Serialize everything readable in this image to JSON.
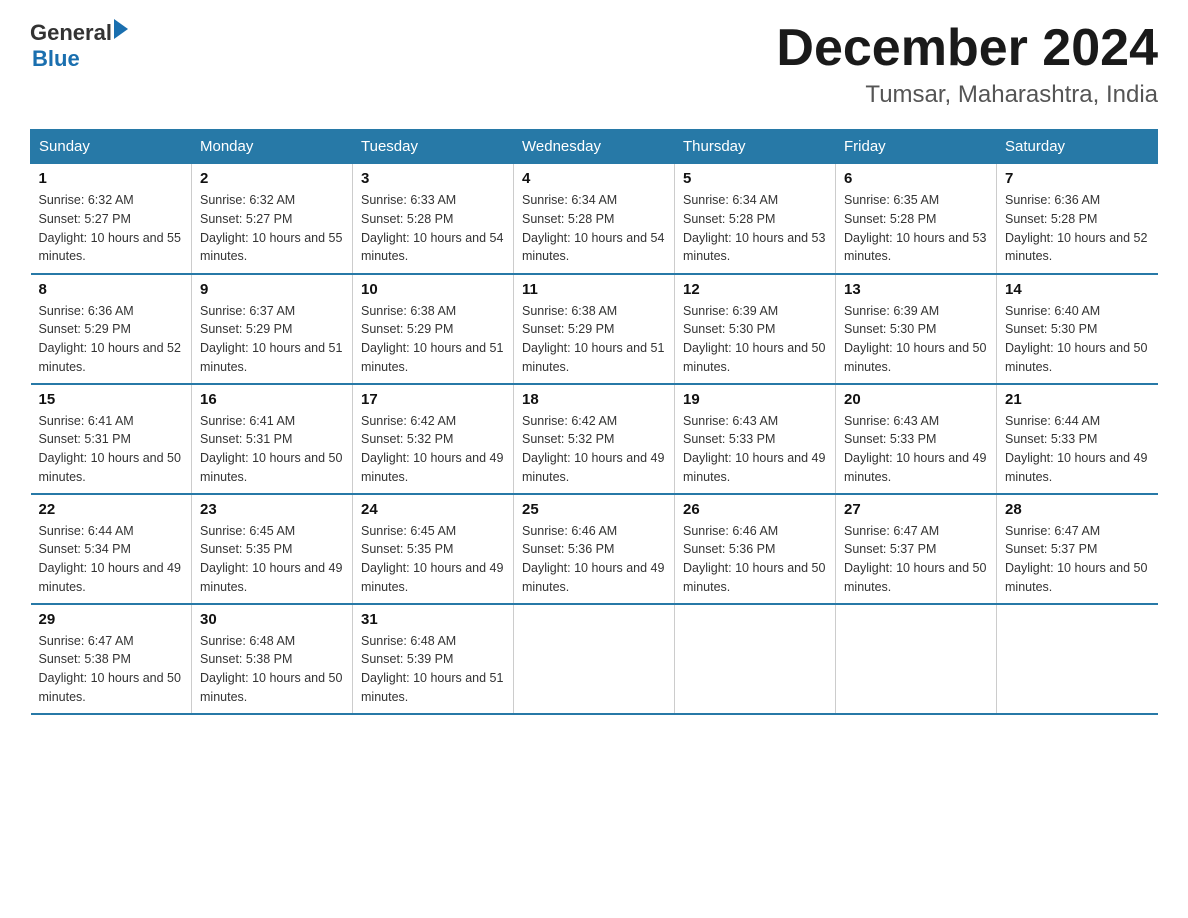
{
  "logo": {
    "general": "General",
    "blue": "Blue"
  },
  "title": "December 2024",
  "location": "Tumsar, Maharashtra, India",
  "days_of_week": [
    "Sunday",
    "Monday",
    "Tuesday",
    "Wednesday",
    "Thursday",
    "Friday",
    "Saturday"
  ],
  "weeks": [
    [
      {
        "day": "1",
        "sunrise": "6:32 AM",
        "sunset": "5:27 PM",
        "daylight": "10 hours and 55 minutes."
      },
      {
        "day": "2",
        "sunrise": "6:32 AM",
        "sunset": "5:27 PM",
        "daylight": "10 hours and 55 minutes."
      },
      {
        "day": "3",
        "sunrise": "6:33 AM",
        "sunset": "5:28 PM",
        "daylight": "10 hours and 54 minutes."
      },
      {
        "day": "4",
        "sunrise": "6:34 AM",
        "sunset": "5:28 PM",
        "daylight": "10 hours and 54 minutes."
      },
      {
        "day": "5",
        "sunrise": "6:34 AM",
        "sunset": "5:28 PM",
        "daylight": "10 hours and 53 minutes."
      },
      {
        "day": "6",
        "sunrise": "6:35 AM",
        "sunset": "5:28 PM",
        "daylight": "10 hours and 53 minutes."
      },
      {
        "day": "7",
        "sunrise": "6:36 AM",
        "sunset": "5:28 PM",
        "daylight": "10 hours and 52 minutes."
      }
    ],
    [
      {
        "day": "8",
        "sunrise": "6:36 AM",
        "sunset": "5:29 PM",
        "daylight": "10 hours and 52 minutes."
      },
      {
        "day": "9",
        "sunrise": "6:37 AM",
        "sunset": "5:29 PM",
        "daylight": "10 hours and 51 minutes."
      },
      {
        "day": "10",
        "sunrise": "6:38 AM",
        "sunset": "5:29 PM",
        "daylight": "10 hours and 51 minutes."
      },
      {
        "day": "11",
        "sunrise": "6:38 AM",
        "sunset": "5:29 PM",
        "daylight": "10 hours and 51 minutes."
      },
      {
        "day": "12",
        "sunrise": "6:39 AM",
        "sunset": "5:30 PM",
        "daylight": "10 hours and 50 minutes."
      },
      {
        "day": "13",
        "sunrise": "6:39 AM",
        "sunset": "5:30 PM",
        "daylight": "10 hours and 50 minutes."
      },
      {
        "day": "14",
        "sunrise": "6:40 AM",
        "sunset": "5:30 PM",
        "daylight": "10 hours and 50 minutes."
      }
    ],
    [
      {
        "day": "15",
        "sunrise": "6:41 AM",
        "sunset": "5:31 PM",
        "daylight": "10 hours and 50 minutes."
      },
      {
        "day": "16",
        "sunrise": "6:41 AM",
        "sunset": "5:31 PM",
        "daylight": "10 hours and 50 minutes."
      },
      {
        "day": "17",
        "sunrise": "6:42 AM",
        "sunset": "5:32 PM",
        "daylight": "10 hours and 49 minutes."
      },
      {
        "day": "18",
        "sunrise": "6:42 AM",
        "sunset": "5:32 PM",
        "daylight": "10 hours and 49 minutes."
      },
      {
        "day": "19",
        "sunrise": "6:43 AM",
        "sunset": "5:33 PM",
        "daylight": "10 hours and 49 minutes."
      },
      {
        "day": "20",
        "sunrise": "6:43 AM",
        "sunset": "5:33 PM",
        "daylight": "10 hours and 49 minutes."
      },
      {
        "day": "21",
        "sunrise": "6:44 AM",
        "sunset": "5:33 PM",
        "daylight": "10 hours and 49 minutes."
      }
    ],
    [
      {
        "day": "22",
        "sunrise": "6:44 AM",
        "sunset": "5:34 PM",
        "daylight": "10 hours and 49 minutes."
      },
      {
        "day": "23",
        "sunrise": "6:45 AM",
        "sunset": "5:35 PM",
        "daylight": "10 hours and 49 minutes."
      },
      {
        "day": "24",
        "sunrise": "6:45 AM",
        "sunset": "5:35 PM",
        "daylight": "10 hours and 49 minutes."
      },
      {
        "day": "25",
        "sunrise": "6:46 AM",
        "sunset": "5:36 PM",
        "daylight": "10 hours and 49 minutes."
      },
      {
        "day": "26",
        "sunrise": "6:46 AM",
        "sunset": "5:36 PM",
        "daylight": "10 hours and 50 minutes."
      },
      {
        "day": "27",
        "sunrise": "6:47 AM",
        "sunset": "5:37 PM",
        "daylight": "10 hours and 50 minutes."
      },
      {
        "day": "28",
        "sunrise": "6:47 AM",
        "sunset": "5:37 PM",
        "daylight": "10 hours and 50 minutes."
      }
    ],
    [
      {
        "day": "29",
        "sunrise": "6:47 AM",
        "sunset": "5:38 PM",
        "daylight": "10 hours and 50 minutes."
      },
      {
        "day": "30",
        "sunrise": "6:48 AM",
        "sunset": "5:38 PM",
        "daylight": "10 hours and 50 minutes."
      },
      {
        "day": "31",
        "sunrise": "6:48 AM",
        "sunset": "5:39 PM",
        "daylight": "10 hours and 51 minutes."
      },
      null,
      null,
      null,
      null
    ]
  ]
}
